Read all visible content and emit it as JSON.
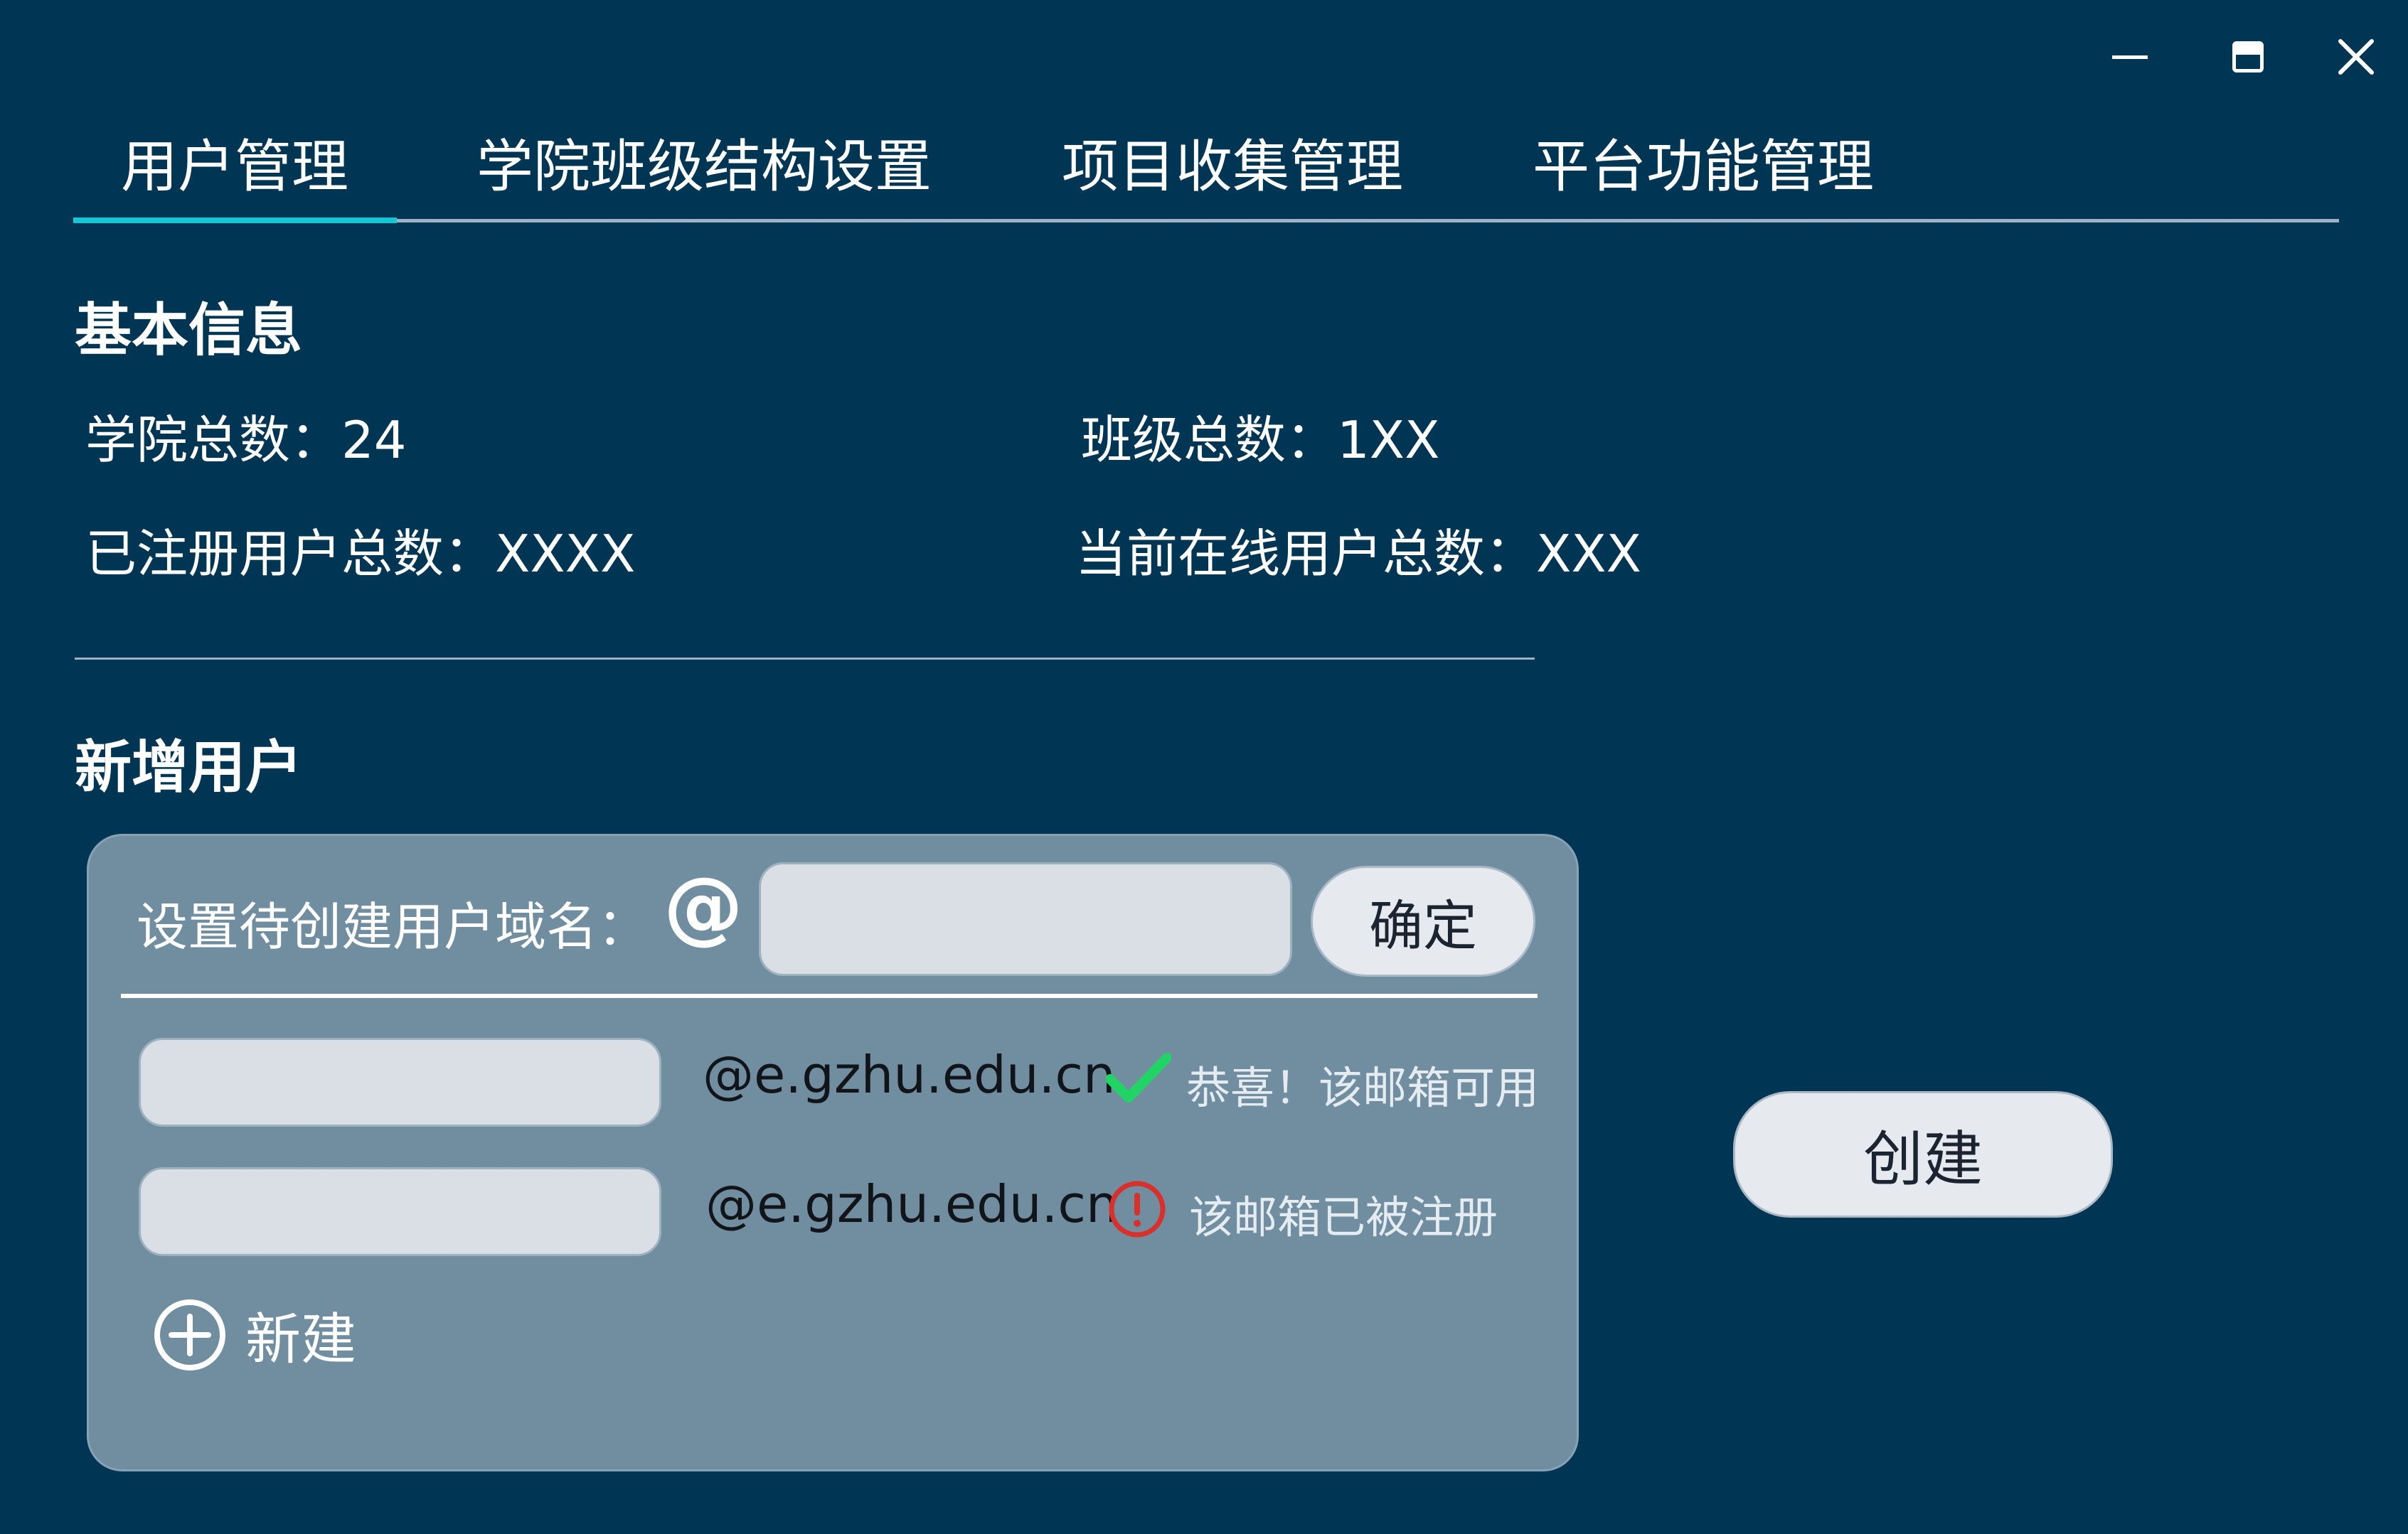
{
  "window": {
    "minimize_icon": "minimize-icon",
    "maximize_icon": "maximize-icon",
    "close_icon": "close-icon"
  },
  "tabs": [
    {
      "label": "用户管理",
      "active": true
    },
    {
      "label": "学院班级结构设置",
      "active": false
    },
    {
      "label": "项目收集管理",
      "active": false
    },
    {
      "label": "平台功能管理",
      "active": false
    }
  ],
  "basic_info": {
    "title": "基本信息",
    "college_total": "学院总数：24",
    "class_total": "班级总数：1XX",
    "registered_total": "已注册用户总数：XXXX",
    "online_total": "当前在线用户总数：XXX"
  },
  "add_user": {
    "title": "新增用户",
    "domain_label": "设置待创建用户域名：",
    "at_symbol": "@",
    "domain_input_value": "",
    "confirm_label": "确定",
    "rows": [
      {
        "value": "",
        "suffix": "@e.gzhu.edu.cn",
        "status": "恭喜！该邮箱可用",
        "status_type": "success"
      },
      {
        "value": "",
        "suffix": "@e.gzhu.edu.cn",
        "status": "该邮箱已被注册",
        "status_type": "error"
      }
    ],
    "add_new_label": "新建",
    "create_label": "创建"
  },
  "colors": {
    "background": "#003554",
    "tab_indicator": "#17c6d4",
    "panel": "#708ea0",
    "success": "#22d466",
    "error": "#d9302c"
  }
}
